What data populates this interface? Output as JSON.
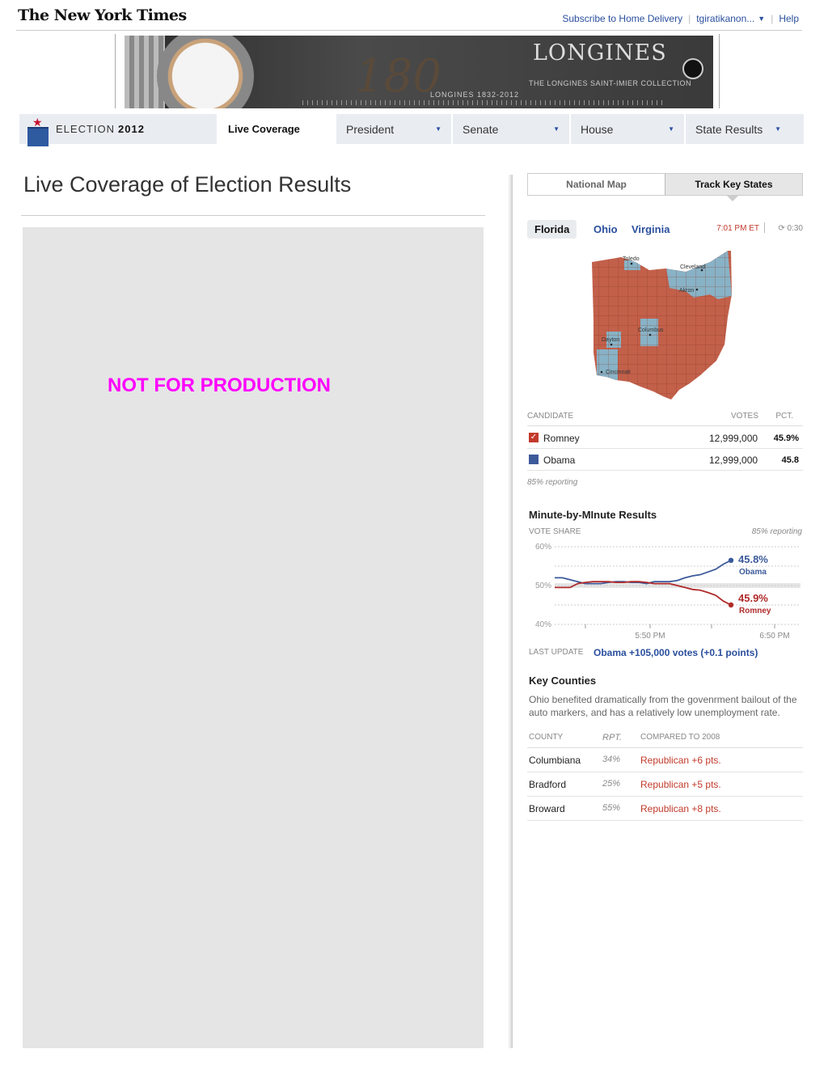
{
  "header": {
    "logo": "The New York Times",
    "links": [
      "Subscribe to Home Delivery",
      "tgiratikanon...",
      "Help"
    ]
  },
  "ad": {
    "number": "180",
    "sub": "LONGINES 1832-2012",
    "brand": "LONGINES",
    "tagline": "THE LONGINES SAINT-IMIER COLLECTION"
  },
  "nav": {
    "election_label": "ELECTION",
    "election_year": "2012",
    "items": [
      "Live Coverage",
      "President",
      "Senate",
      "House",
      "State Results"
    ]
  },
  "main": {
    "title": "Live Coverage of Election Results",
    "placeholder_text": "NOT FOR PRODUCTION"
  },
  "sidebar": {
    "tabs": [
      "National Map",
      "Track Key States"
    ],
    "states": [
      "Florida",
      "Ohio",
      "Virginia"
    ],
    "time": "7:01 PM ET",
    "countdown": "0:30",
    "map_cities": [
      "Toledo",
      "Cleveland",
      "Akron",
      "Columbus",
      "Dayton",
      "Cincinnati"
    ],
    "candidates_header": {
      "candidate": "CANDIDATE",
      "votes": "VOTES",
      "pct": "PCT."
    },
    "candidates": [
      {
        "name": "Romney",
        "votes": "12,999,000",
        "pct": "45.9%",
        "color": "#c23a2b",
        "winner": true
      },
      {
        "name": "Obama",
        "votes": "12,999,000",
        "pct": "45.8",
        "color": "#3c5a9a",
        "winner": false
      }
    ],
    "reporting": "85% reporting",
    "minute": {
      "title": "Minute-by-MInute Results",
      "subtitle": "VOTE SHARE",
      "reporting": "85% reporting",
      "last_update_label": "LAST UPDATE",
      "last_update": "Obama +105,000 votes (+0.1 points)"
    },
    "key_counties": {
      "title": "Key Counties",
      "description": "Ohio benefited dramatically from the govenrment bailout of the auto markers, and has a relatively low unemployment rate.",
      "header": {
        "county": "COUNTY",
        "rpt": "RPT.",
        "compared": "COMPARED TO 2008"
      },
      "rows": [
        {
          "county": "Columbiana",
          "rpt": "34%",
          "compared": "Republican +6 pts."
        },
        {
          "county": "Bradford",
          "rpt": "25%",
          "compared": "Republican +5 pts."
        },
        {
          "county": "Broward",
          "rpt": "55%",
          "compared": "Republican +8 pts."
        }
      ]
    }
  },
  "chart_data": {
    "type": "line",
    "ylabel": "VOTE SHARE",
    "ylim": [
      40,
      60
    ],
    "y_ticks": [
      "60%",
      "50%",
      "40%"
    ],
    "x_ticks": [
      "5:50 PM",
      "6:50 PM"
    ],
    "grid": true,
    "series": [
      {
        "name": "Obama",
        "label": "45.8%",
        "color": "#3c5a9a",
        "values": [
          52,
          52,
          51.5,
          51,
          50.5,
          50.5,
          50.5,
          50.8,
          51,
          51,
          50.8,
          50.8,
          50.5,
          51,
          51,
          51,
          51.3,
          52,
          52.5,
          52.8,
          53.5,
          54.2,
          55.5,
          56.5
        ]
      },
      {
        "name": "Romney",
        "label": "45.9%",
        "color": "#b02a2a",
        "values": [
          49.5,
          49.5,
          49.5,
          50.5,
          50.8,
          51,
          51,
          51,
          50.8,
          50.8,
          51,
          51,
          50.8,
          50.5,
          50.5,
          50.5,
          50,
          49.5,
          49,
          48.8,
          48.2,
          47.5,
          46,
          45
        ]
      }
    ]
  }
}
